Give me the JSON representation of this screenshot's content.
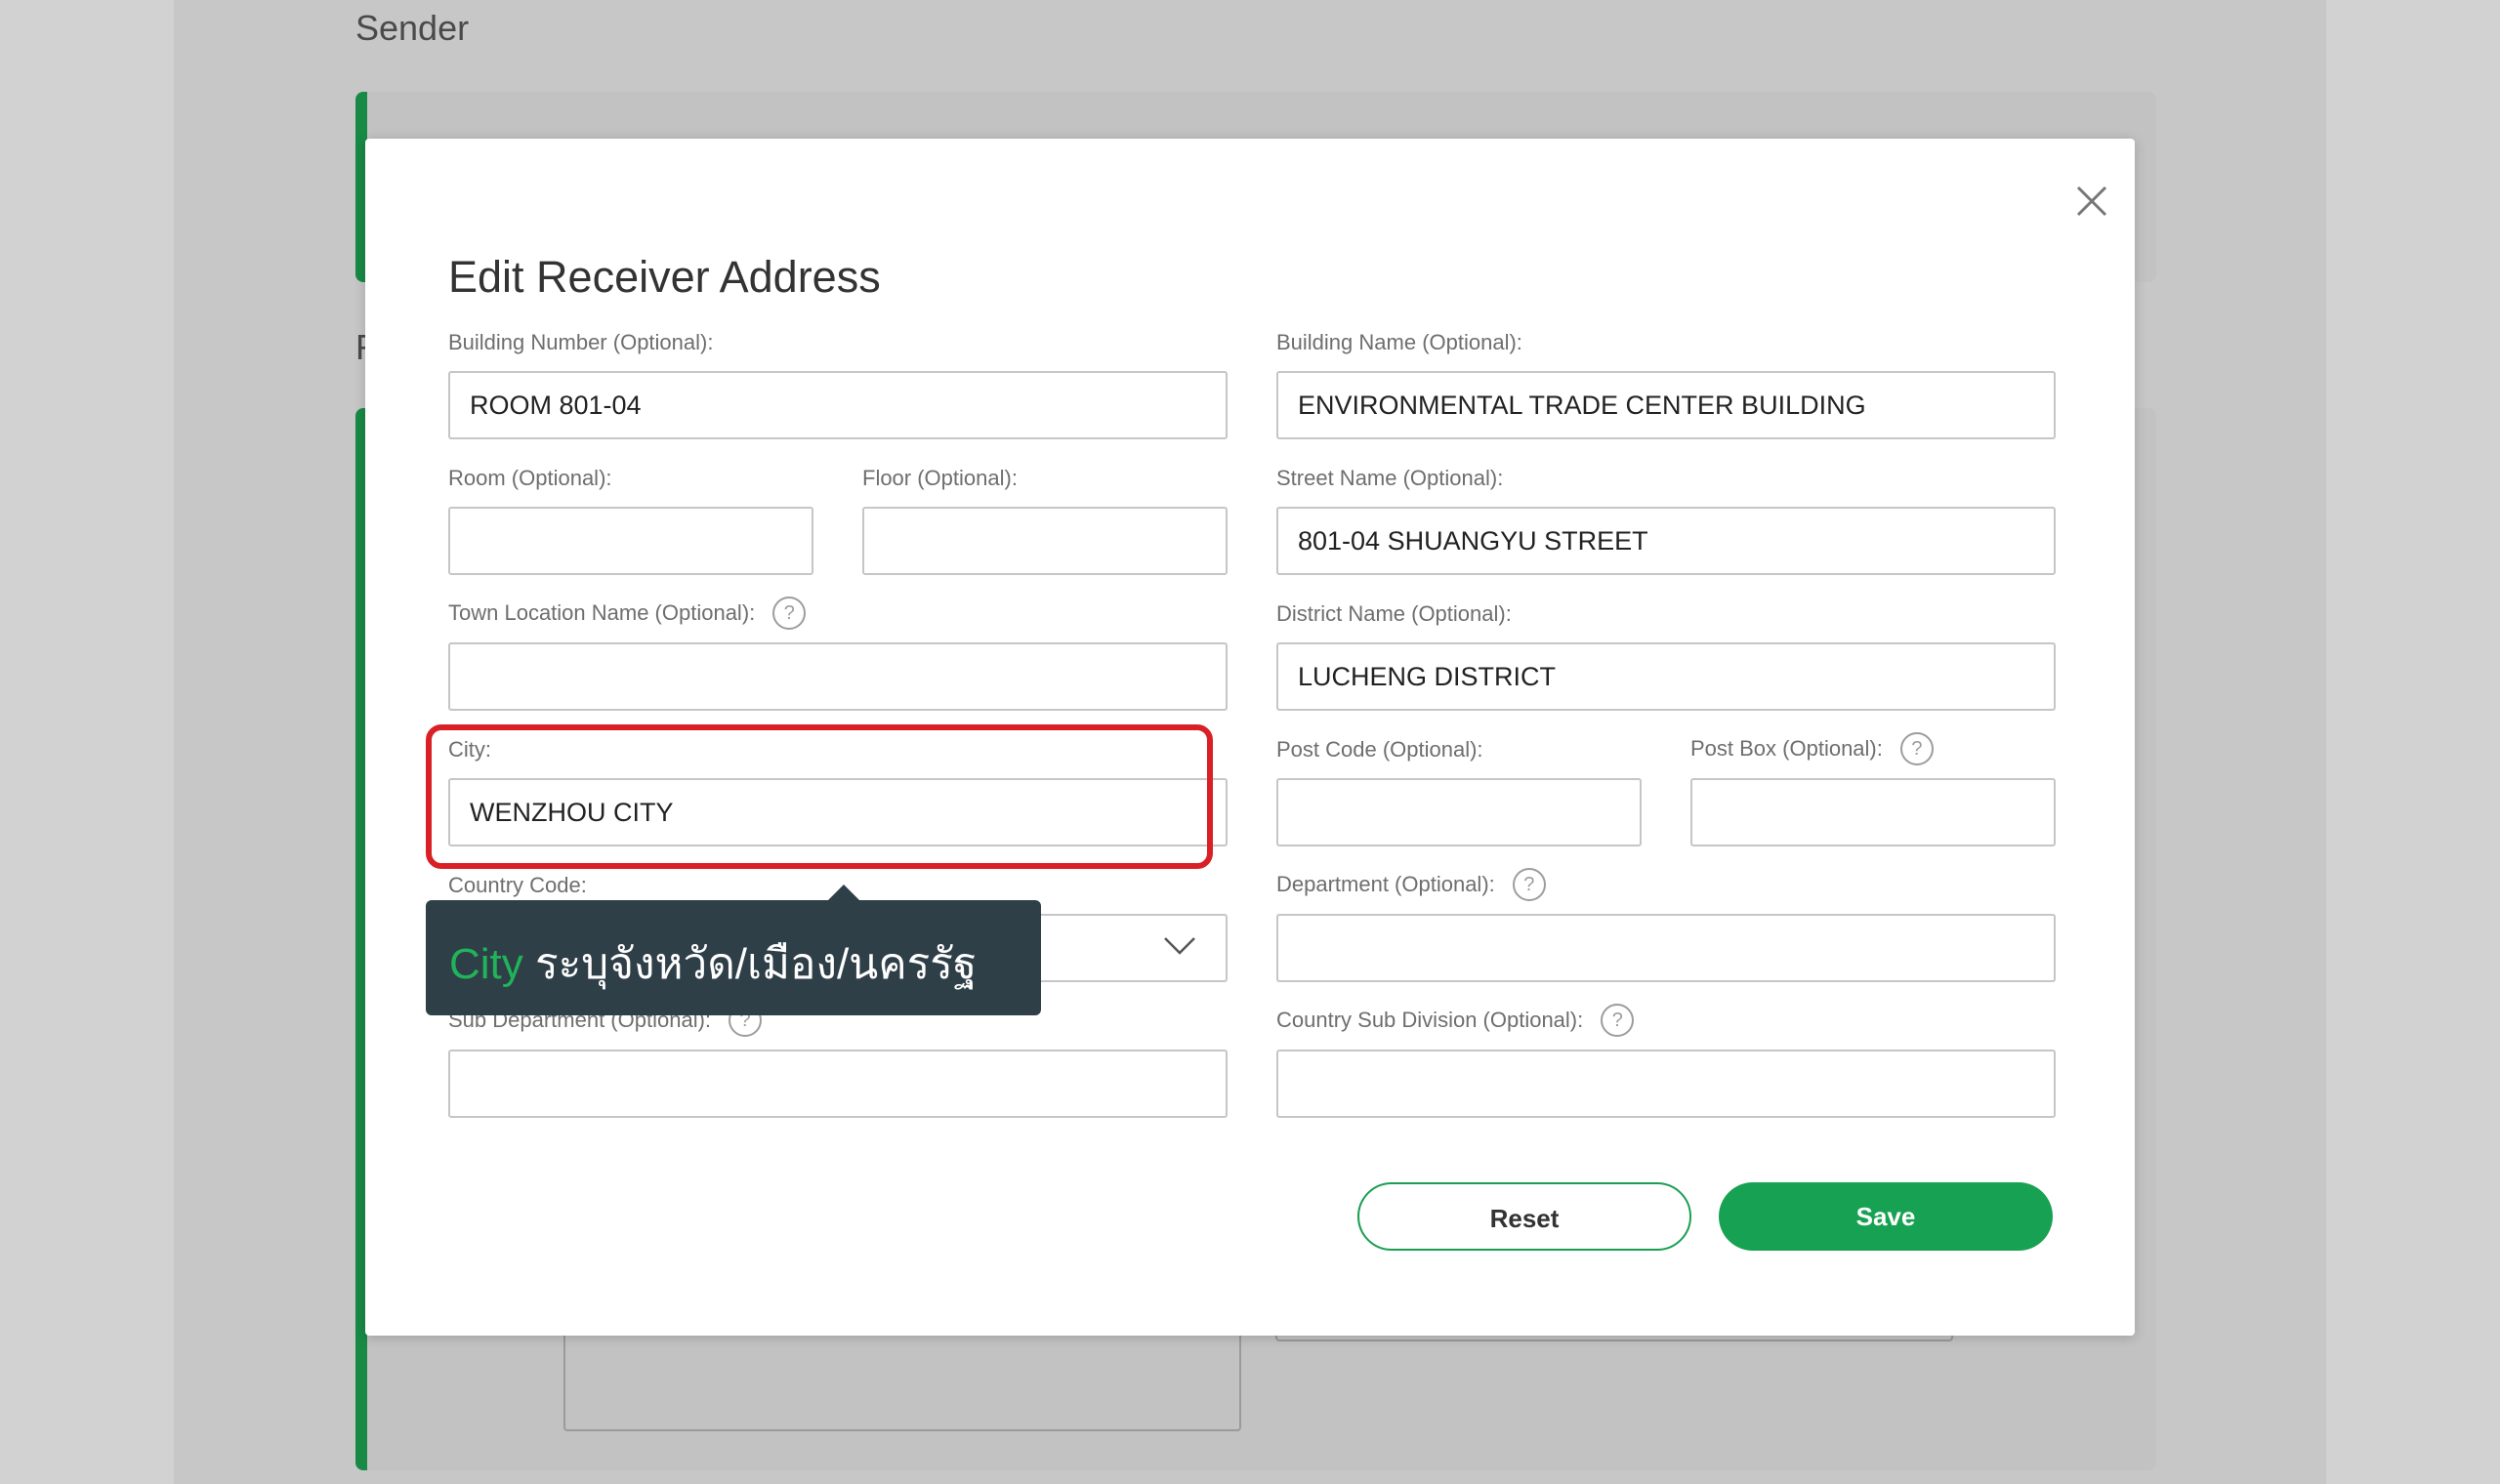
{
  "background": {
    "section_title": "Sender",
    "partial_label": "R"
  },
  "modal": {
    "title": "Edit Receiver Address",
    "fields": {
      "building_number": {
        "label": "Building Number (Optional):",
        "value": "ROOM 801-04"
      },
      "building_name": {
        "label": "Building Name (Optional):",
        "value": "ENVIRONMENTAL TRADE CENTER BUILDING"
      },
      "room": {
        "label": "Room (Optional):",
        "value": ""
      },
      "floor": {
        "label": "Floor (Optional):",
        "value": ""
      },
      "street_name": {
        "label": "Street Name (Optional):",
        "value": "801-04 SHUANGYU STREET"
      },
      "town_location": {
        "label": "Town Location Name (Optional):",
        "value": ""
      },
      "district_name": {
        "label": "District Name (Optional):",
        "value": "LUCHENG DISTRICT"
      },
      "city": {
        "label": "City:",
        "value": "WENZHOU CITY"
      },
      "post_code": {
        "label": "Post Code (Optional):",
        "value": ""
      },
      "post_box": {
        "label": "Post Box (Optional):",
        "value": ""
      },
      "country_code": {
        "label": "Country Code:",
        "value": ""
      },
      "department": {
        "label": "Department (Optional):",
        "value": ""
      },
      "sub_department": {
        "label": "Sub Department (Optional):",
        "value": ""
      },
      "country_sub_division": {
        "label": "Country Sub Division (Optional):",
        "value": ""
      }
    },
    "help_icon_glyph": "?",
    "buttons": {
      "reset": "Reset",
      "save": "Save"
    }
  },
  "tooltip": {
    "keyword": "City",
    "text": "ระบุจังหวัด/เมือง/นครรัฐ"
  },
  "colors": {
    "accent_green": "#17a152",
    "highlight_red": "#d92027",
    "tooltip_bg": "#2f3f48"
  }
}
